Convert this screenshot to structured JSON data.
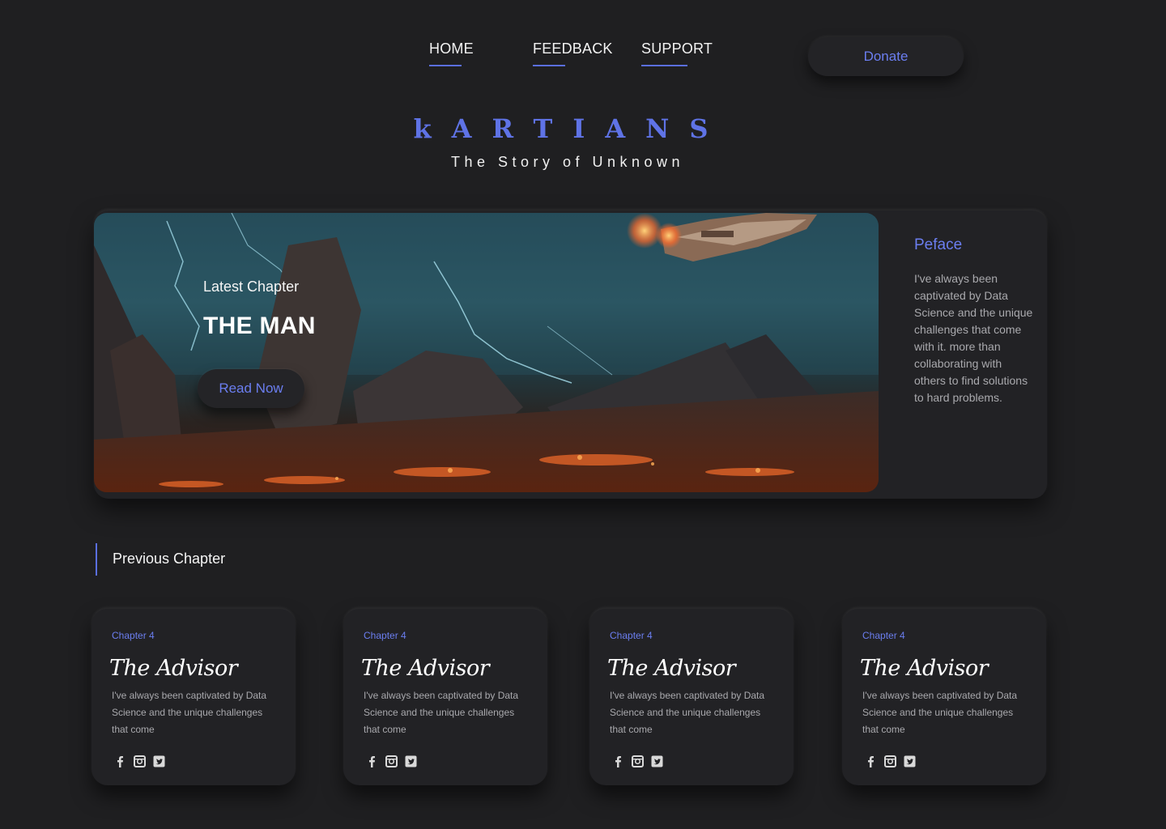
{
  "nav": {
    "items": [
      {
        "label": "HOME"
      },
      {
        "label": "FEEDBACK"
      },
      {
        "label": "SUPPORT"
      }
    ],
    "donate_label": "Donate"
  },
  "brand": {
    "title": "kARTIANS",
    "tagline": "The Story of Unknown"
  },
  "hero": {
    "subtitle": "Latest Chapter",
    "title": "THE MAN",
    "button_label": "Read Now"
  },
  "preface": {
    "title": "Peface",
    "text": "I've always been captivated by Data Science and the unique challenges that come with it. more than collaborating with others to find solutions to hard problems."
  },
  "previous": {
    "heading": "Previous Chapter",
    "cards": [
      {
        "chapter": "Chapter 4",
        "title": "The Advisor",
        "description": "I've always been captivated by Data Science and the unique challenges that come"
      },
      {
        "chapter": "Chapter 4",
        "title": "The Advisor",
        "description": "I've always been captivated by Data Science and the unique challenges that come"
      },
      {
        "chapter": "Chapter 4",
        "title": "The Advisor",
        "description": "I've always been captivated by Data Science and the unique challenges that come"
      },
      {
        "chapter": "Chapter 4",
        "title": "The Advisor",
        "description": "I've always been captivated by Data Science and the unique challenges that come"
      }
    ]
  },
  "colors": {
    "background": "#1f1f21",
    "accent": "#6b7ef0",
    "card": "#222225"
  },
  "icons": [
    "facebook-icon",
    "instagram-icon",
    "twitter-icon"
  ]
}
